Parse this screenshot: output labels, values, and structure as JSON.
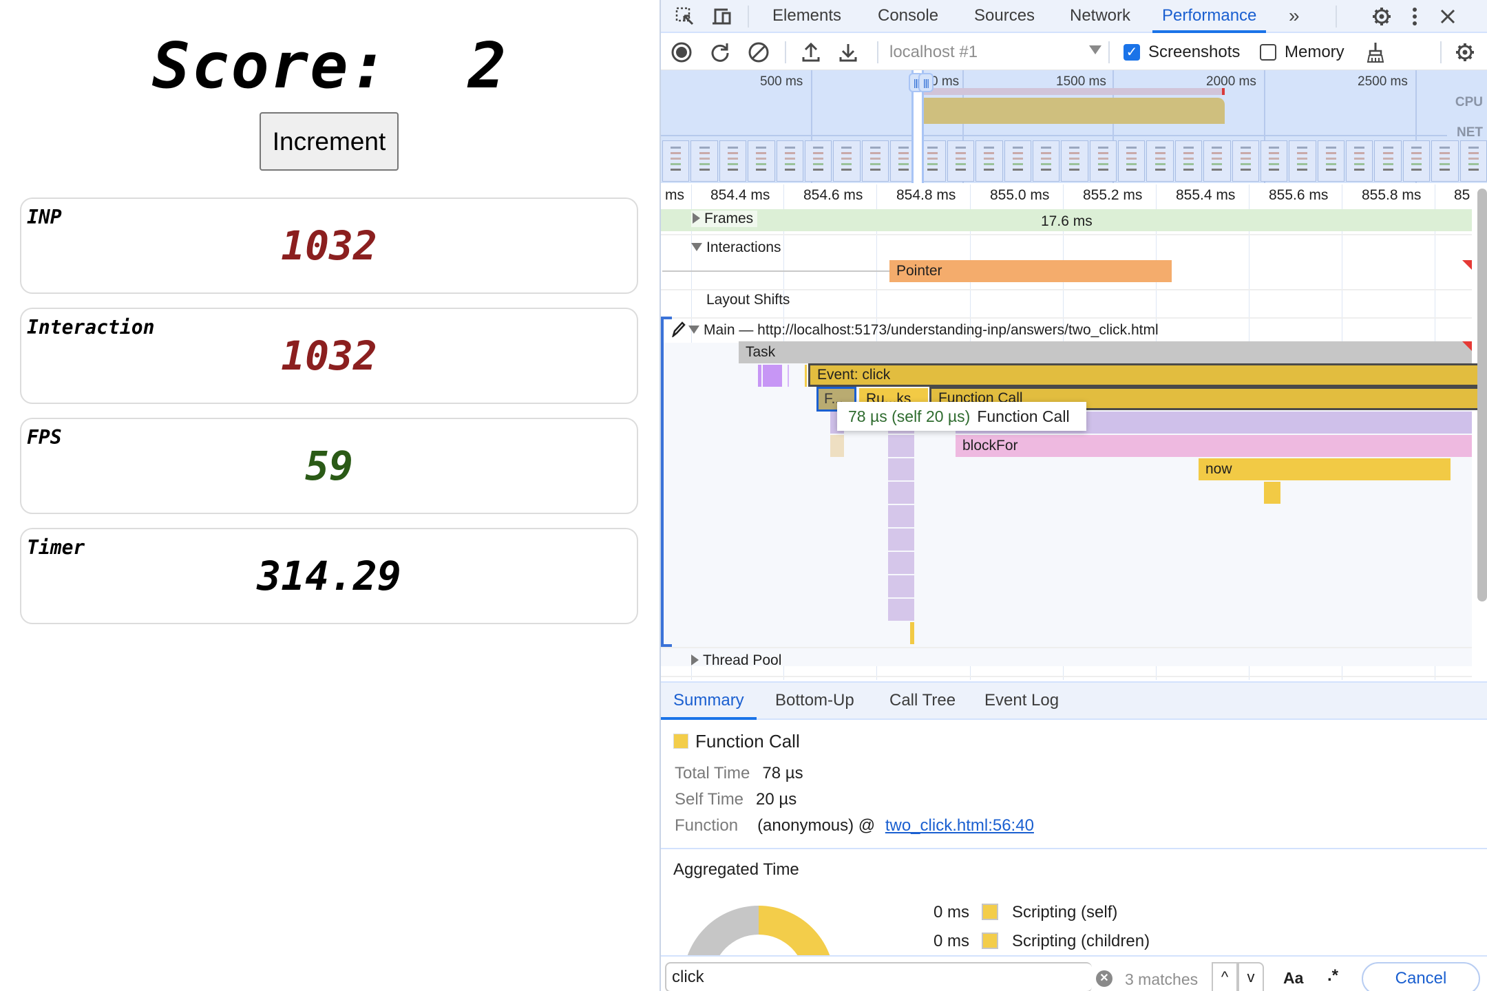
{
  "app": {
    "score_label": "Score:  2",
    "increment_label": "Increment",
    "cards": [
      {
        "label": "INP",
        "value": "1032",
        "color": "#8b1f1f"
      },
      {
        "label": "Interaction",
        "value": "1032",
        "color": "#8b1f1f"
      },
      {
        "label": "FPS",
        "value": "59",
        "color": "#2a5a16"
      },
      {
        "label": "Timer",
        "value": "314.29",
        "color": "#000000"
      }
    ]
  },
  "devtools": {
    "tabs": [
      "Elements",
      "Console",
      "Sources",
      "Network",
      "Performance"
    ],
    "active_tab": "Performance",
    "more_tabs": "»",
    "toolbar": {
      "target": "localhost #1",
      "screenshots_label": "Screenshots",
      "screenshots_checked": true,
      "memory_label": "Memory",
      "memory_checked": false
    },
    "overview": {
      "ticks": [
        "500 ms",
        "1000 ms",
        "1500 ms",
        "2000 ms",
        "2500 ms"
      ],
      "tick_visible": [
        "500 ms",
        "0 ms",
        "1500 ms",
        "2000 ms",
        "2500 ms"
      ],
      "cpu_label": "CPU",
      "net_label": "NET"
    },
    "ruler": [
      "ms",
      "854.4 ms",
      "854.6 ms",
      "854.8 ms",
      "855.0 ms",
      "855.2 ms",
      "855.4 ms",
      "855.6 ms",
      "855.8 ms",
      "85"
    ],
    "tracks": {
      "frames_label": "Frames",
      "frames_duration": "17.6 ms",
      "interactions_label": "Interactions",
      "interaction_bar": "Pointer",
      "layout_shifts_label": "Layout Shifts",
      "main_label": "Main — http://localhost:5173/understanding-inp/answers/two_click.html",
      "thread_pool_label": "Thread Pool"
    },
    "flame": {
      "task": "Task",
      "event_click": "Event: click",
      "f_short": "F...",
      "run_tasks": "Ru...ks",
      "function_call": "Function Call",
      "block_for": "blockFor",
      "now": "now"
    },
    "tooltip": {
      "time": "78 µs (self 20 µs)",
      "name": "Function Call"
    },
    "bottom_tabs": [
      "Summary",
      "Bottom-Up",
      "Call Tree",
      "Event Log"
    ],
    "active_bottom_tab": "Summary",
    "summary": {
      "title": "Function Call",
      "swatch_color": "#f3cd4a",
      "total_time_label": "Total Time",
      "total_time": "78 µs",
      "self_time_label": "Self Time",
      "self_time": "20 µs",
      "function_label": "Function",
      "function_value": "(anonymous) @",
      "function_link": "two_click.html:56:40"
    },
    "aggregated": {
      "title": "Aggregated Time",
      "rows": [
        {
          "value": "0 ms",
          "label": "Scripting (self)"
        },
        {
          "value": "0 ms",
          "label": "Scripting (children)"
        }
      ]
    },
    "search": {
      "query": "click",
      "matches": "3 matches",
      "case_label": "Aa",
      "regex_label": ".*",
      "cancel_label": "Cancel"
    }
  }
}
